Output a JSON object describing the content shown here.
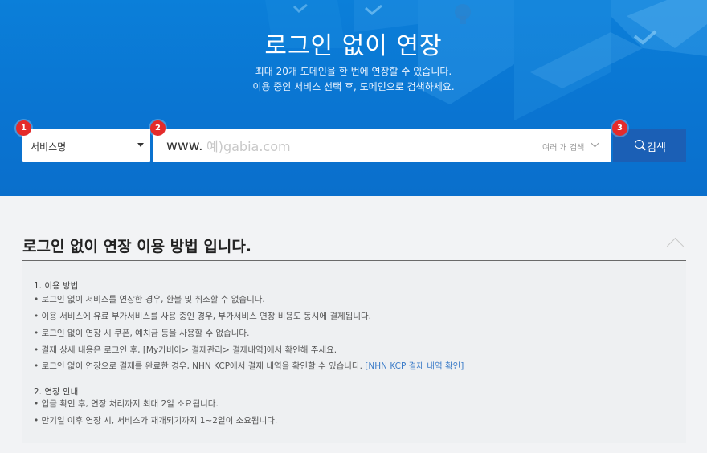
{
  "hero": {
    "title": "로그인 없이 연장",
    "subtitle_line1": "최대 20개 도메인을 한 번에 연장할 수 있습니다.",
    "subtitle_line2": "이용 중인 서비스 선택 후, 도메인으로 검색하세요.",
    "background_color": "#0b7fd9"
  },
  "search": {
    "service_select": {
      "selected": "서비스명",
      "badge": "1"
    },
    "domain": {
      "prefix": "www.",
      "placeholder": "예)gabia.com",
      "value": "",
      "badge": "2",
      "multi_search_label": "여러 개 검색"
    },
    "button": {
      "label": "검색",
      "badge": "3",
      "icon": "search-icon",
      "color": "#1b5fb5"
    },
    "badge_color": "#e42b2b"
  },
  "guide": {
    "title": "로그인 없이 연장 이용 방법 입니다.",
    "toggle_icon": "chevron-up-icon",
    "sections": [
      {
        "title": "1. 이용 방법",
        "items": [
          "• 로그인 없이 서비스를 연장한 경우, 환불 및 취소할 수 없습니다.",
          "• 이용 서비스에 유료 부가서비스를 사용 중인 경우, 부가서비스 연장 비용도 동시에 결제됩니다.",
          "• 로그인 없이 연장 시 쿠폰, 예치금 등을 사용할 수 없습니다.",
          "• 결제 상세 내용은 로그인 후, [My가비아> 결제관리> 결제내역]에서 확인해 주세요.",
          "• 로그인 없이 연장으로 결제를 완료한 경우, NHN KCP에서 결제 내역을 확인할 수 있습니다. "
        ],
        "link": "[NHN KCP 결제 내역 확인]"
      },
      {
        "title": "2. 연장 안내",
        "items": [
          "• 입금 확인 후, 연장 처리까지 최대 2일 소요됩니다.",
          "• 만기일 이후 연장 시, 서비스가 재개되기까지 1~2일이 소요됩니다."
        ]
      }
    ],
    "link_color": "#3a7bc8"
  }
}
